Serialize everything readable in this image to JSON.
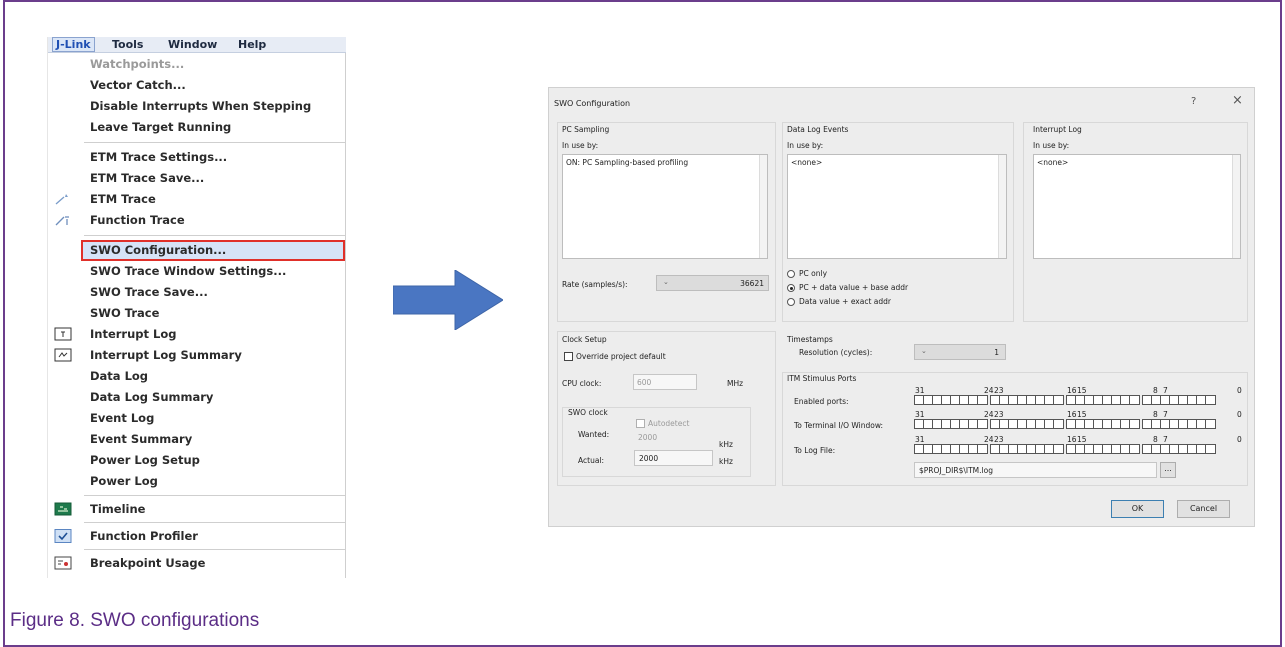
{
  "menubar": [
    "J-Link",
    "Tools",
    "Window",
    "Help"
  ],
  "menu_items": {
    "watchpoints": "Watchpoints...",
    "vector_catch": "Vector Catch...",
    "disable_interrupts": "Disable Interrupts When Stepping",
    "leave_target": "Leave Target Running",
    "etm_settings": "ETM Trace Settings...",
    "etm_save": "ETM Trace Save...",
    "etm_trace": "ETM Trace",
    "function_trace": "Function Trace",
    "swo_config": "SWO Configuration...",
    "swo_window_settings": "SWO Trace Window Settings...",
    "swo_save": "SWO Trace Save...",
    "swo_trace": "SWO Trace",
    "interrupt_log": "Interrupt Log",
    "interrupt_log_summary": "Interrupt Log Summary",
    "data_log": "Data Log",
    "data_log_summary": "Data Log Summary",
    "event_log": "Event Log",
    "event_summary": "Event Summary",
    "power_log_setup": "Power Log Setup",
    "power_log": "Power Log",
    "timeline": "Timeline",
    "function_profiler": "Function Profiler",
    "breakpoint_usage": "Breakpoint Usage"
  },
  "dialog": {
    "title": "SWO Configuration",
    "help_btn": "?",
    "close_btn": "×",
    "pc_sampling": {
      "title": "PC Sampling",
      "in_use_label": "In use by:",
      "in_use_value": "ON: PC Sampling-based profiling",
      "rate_label": "Rate (samples/s):",
      "rate_value": "36621"
    },
    "data_log": {
      "title": "Data Log Events",
      "in_use_label": "In use by:",
      "in_use_value": "<none>",
      "radio1": "PC only",
      "radio2": "PC + data value + base addr",
      "radio3": "Data value + exact addr"
    },
    "interrupt_log": {
      "title": "Interrupt Log",
      "in_use_label": "In use by:",
      "in_use_value": "<none>"
    },
    "clock": {
      "title": "Clock Setup",
      "override_label": "Override project default",
      "cpu_label": "CPU clock:",
      "cpu_value": "600",
      "cpu_unit": "MHz",
      "swo_title": "SWO clock",
      "autodetect_label": "Autodetect",
      "wanted_label": "Wanted:",
      "wanted_value": "2000",
      "wanted_unit": "kHz",
      "actual_label": "Actual:",
      "actual_value": "2000",
      "actual_unit": "kHz"
    },
    "timestamps": {
      "title": "Timestamps",
      "resolution_label": "Resolution (cycles):",
      "resolution_value": "1"
    },
    "itm": {
      "title": "ITM Stimulus Ports",
      "enabled_label": "Enabled ports:",
      "terminal_label": "To Terminal I/O Window:",
      "logfile_label": "To Log File:",
      "bit_labels": [
        "31",
        "24",
        "23",
        "16",
        "15",
        "8",
        "7",
        "0"
      ],
      "logfile_path": "$PROJ_DIR$\\ITM.log",
      "browse": "..."
    },
    "ok": "OK",
    "cancel": "Cancel"
  },
  "caption": "Figure 8.  SWO configurations"
}
